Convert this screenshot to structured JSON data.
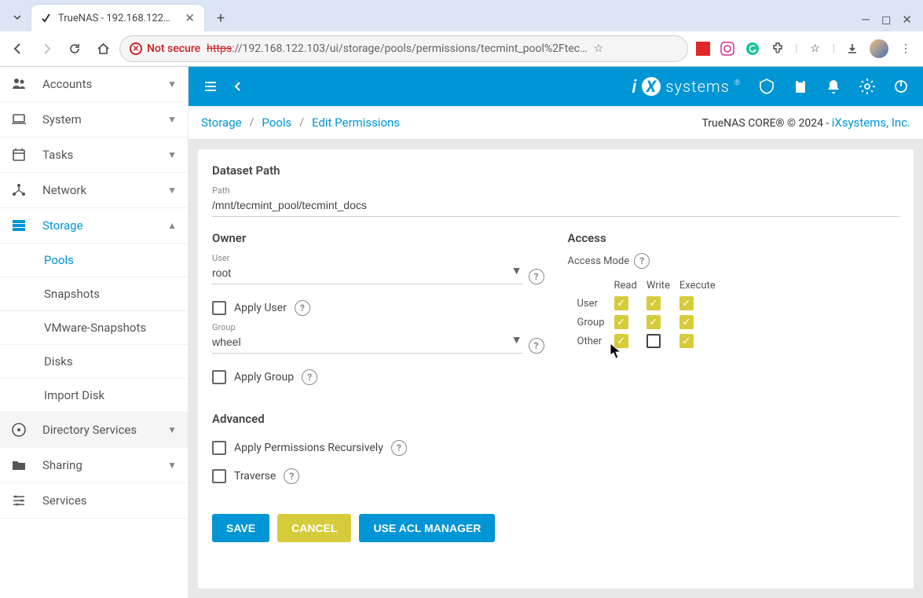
{
  "browser": {
    "tab_title": "TrueNAS - 192.168.122…",
    "not_secure_label": "Not secure",
    "url_https": "https",
    "url_rest": "://192.168.122.103/ui/storage/pools/permissions/tecmint_pool%2Ftec…"
  },
  "topbar": {
    "brand": "systems"
  },
  "sidebar": {
    "items": [
      {
        "label": "Accounts",
        "expandable": true
      },
      {
        "label": "System",
        "expandable": true
      },
      {
        "label": "Tasks",
        "expandable": true
      },
      {
        "label": "Network",
        "expandable": true
      },
      {
        "label": "Storage",
        "expandable": true,
        "active": true,
        "expanded": true
      },
      {
        "label": "Directory Services",
        "expandable": true
      },
      {
        "label": "Sharing",
        "expandable": true
      },
      {
        "label": "Services",
        "expandable": false
      }
    ],
    "storage_children": [
      {
        "label": "Pools",
        "active": true
      },
      {
        "label": "Snapshots"
      },
      {
        "label": "VMware-Snapshots"
      },
      {
        "label": "Disks"
      },
      {
        "label": "Import Disk"
      }
    ]
  },
  "breadcrumb": {
    "parts": [
      "Storage",
      "Pools",
      "Edit Permissions"
    ]
  },
  "copyright": {
    "text": "TrueNAS CORE® © 2024 - ",
    "link": "iXsystems, Inc."
  },
  "dataset": {
    "section": "Dataset Path",
    "path_label": "Path",
    "path_value": "/mnt/tecmint_pool/tecmint_docs"
  },
  "owner": {
    "section": "Owner",
    "user_label": "User",
    "user_value": "root",
    "apply_user": "Apply User",
    "group_label": "Group",
    "group_value": "wheel",
    "apply_group": "Apply Group"
  },
  "access": {
    "section": "Access",
    "mode_label": "Access Mode",
    "cols": [
      "Read",
      "Write",
      "Execute"
    ],
    "rows": [
      "User",
      "Group",
      "Other"
    ],
    "matrix": [
      [
        true,
        true,
        true
      ],
      [
        true,
        true,
        true
      ],
      [
        true,
        false,
        true
      ]
    ]
  },
  "advanced": {
    "section": "Advanced",
    "recursive": "Apply Permissions Recursively",
    "traverse": "Traverse"
  },
  "buttons": {
    "save": "SAVE",
    "cancel": "CANCEL",
    "acl": "USE ACL MANAGER"
  }
}
